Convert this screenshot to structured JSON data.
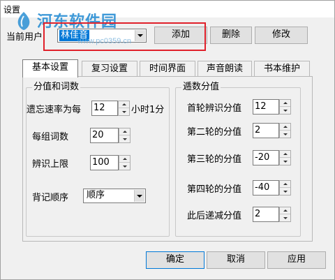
{
  "window": {
    "title": "设置"
  },
  "watermark": {
    "brand": "河东软件园",
    "url": "www.pc0359.cn"
  },
  "header": {
    "user_label": "当前用户",
    "user_value": "林佳音",
    "add_label": "添加",
    "delete_label": "删除",
    "edit_label": "修改"
  },
  "tabs": [
    {
      "label": "基本设置"
    },
    {
      "label": "复习设置"
    },
    {
      "label": "时间界面"
    },
    {
      "label": "声音朗读"
    },
    {
      "label": "书本维护"
    }
  ],
  "score_group": {
    "title": "分值和词数",
    "forget_rate_label": "遗忘速率为每",
    "forget_rate_value": "12",
    "forget_rate_unit": "小时1分",
    "words_per_group_label": "每组词数",
    "words_per_group_value": "20",
    "recognize_limit_label": "辨识上限",
    "recognize_limit_value": "100",
    "order_label": "背记顺序",
    "order_value": "顺序"
  },
  "decrement_group": {
    "title": "逓数分值",
    "rows": [
      {
        "label": "首轮辨识分值",
        "value": "12"
      },
      {
        "label": "第二轮的分值",
        "value": "2"
      },
      {
        "label": "第三轮的分值",
        "value": "-20"
      },
      {
        "label": "第四轮的分值",
        "value": "-40"
      },
      {
        "label": "此后递减分值",
        "value": "2"
      }
    ]
  },
  "footer": {
    "ok_label": "确定",
    "cancel_label": "取消",
    "apply_label": "应用"
  }
}
